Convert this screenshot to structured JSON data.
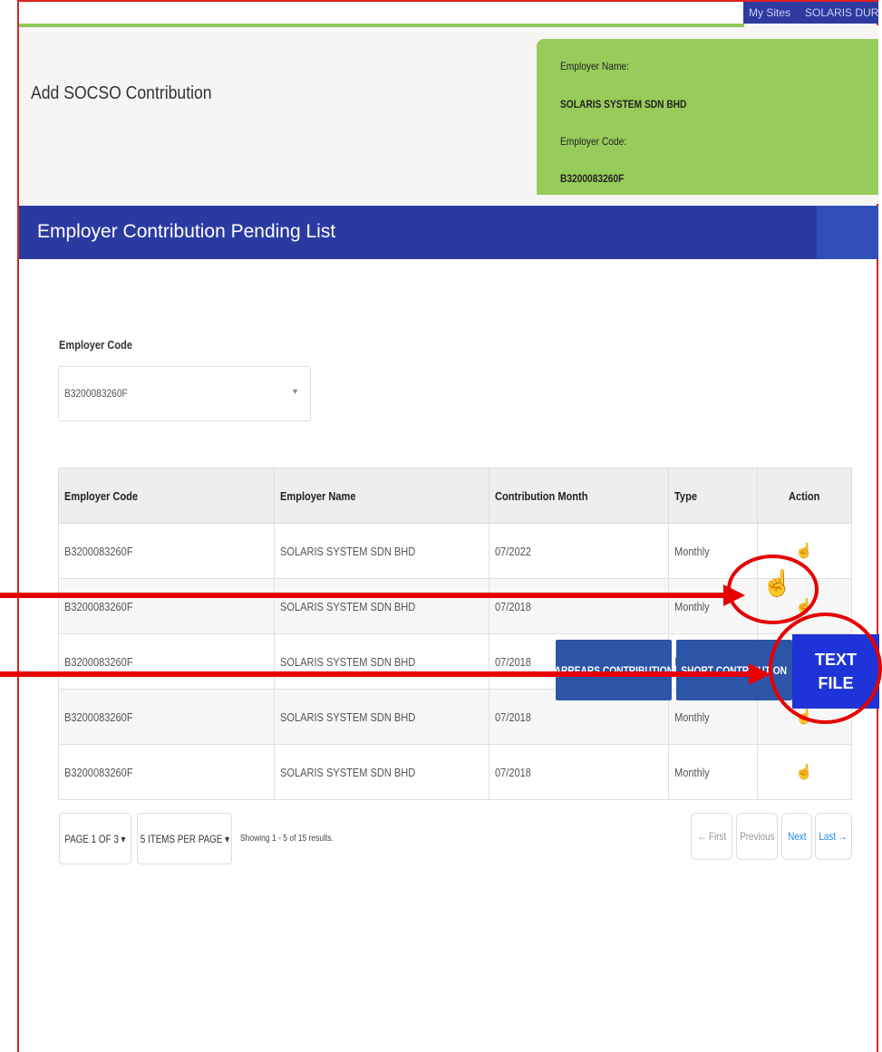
{
  "topbar": {
    "my_sites": "My Sites",
    "user": "SOLARIS DUREA"
  },
  "header": {
    "page_title": "Add SOCSO Contribution"
  },
  "employer_card": {
    "name_label": "Employer Name:",
    "name_value": "SOLARIS SYSTEM SDN BHD",
    "code_label": "Employer Code:",
    "code_value": "B3200083260F"
  },
  "banner": {
    "title": "Employer Contribution Pending List"
  },
  "filter": {
    "label": "Employer Code",
    "selected": "B3200083260F"
  },
  "table": {
    "columns": [
      "Employer Code",
      "Employer Name",
      "Contribution Month",
      "Type",
      "Action"
    ],
    "rows": [
      {
        "code": "B3200083260F",
        "name": "SOLARIS SYSTEM SDN BHD",
        "month": "07/2022",
        "type": "Monthly"
      },
      {
        "code": "B3200083260F",
        "name": "SOLARIS SYSTEM SDN BHD",
        "month": "07/2018",
        "type": "Monthly"
      },
      {
        "code": "B3200083260F",
        "name": "SOLARIS SYSTEM SDN BHD",
        "month": "07/2018",
        "type": "Monthly"
      },
      {
        "code": "B3200083260F",
        "name": "SOLARIS SYSTEM SDN BHD",
        "month": "07/2018",
        "type": "Monthly"
      },
      {
        "code": "B3200083260F",
        "name": "SOLARIS SYSTEM SDN BHD",
        "month": "07/2018",
        "type": "Monthly"
      }
    ]
  },
  "pager": {
    "page": "PAGE 1 OF 3 ▾",
    "per_page": "5 ITEMS PER PAGE ▾",
    "showing": "Showing 1 - 5 of 15 results.",
    "first": "← First",
    "previous": "Previous",
    "next": "Next",
    "last": "Last →"
  },
  "actions": {
    "arrears": "ARREARS CONTRIBUTION",
    "short": "SHORT CONTRIBUTION",
    "text_file_line1": "TEXT",
    "text_file_line2": "FILE"
  },
  "colors": {
    "banner": "#2b3aa1",
    "card": "#98cc5a",
    "button": "#2c55a8",
    "text_file": "#1f34d8",
    "annotation": "#e60000",
    "icon": "#1e88e5"
  }
}
